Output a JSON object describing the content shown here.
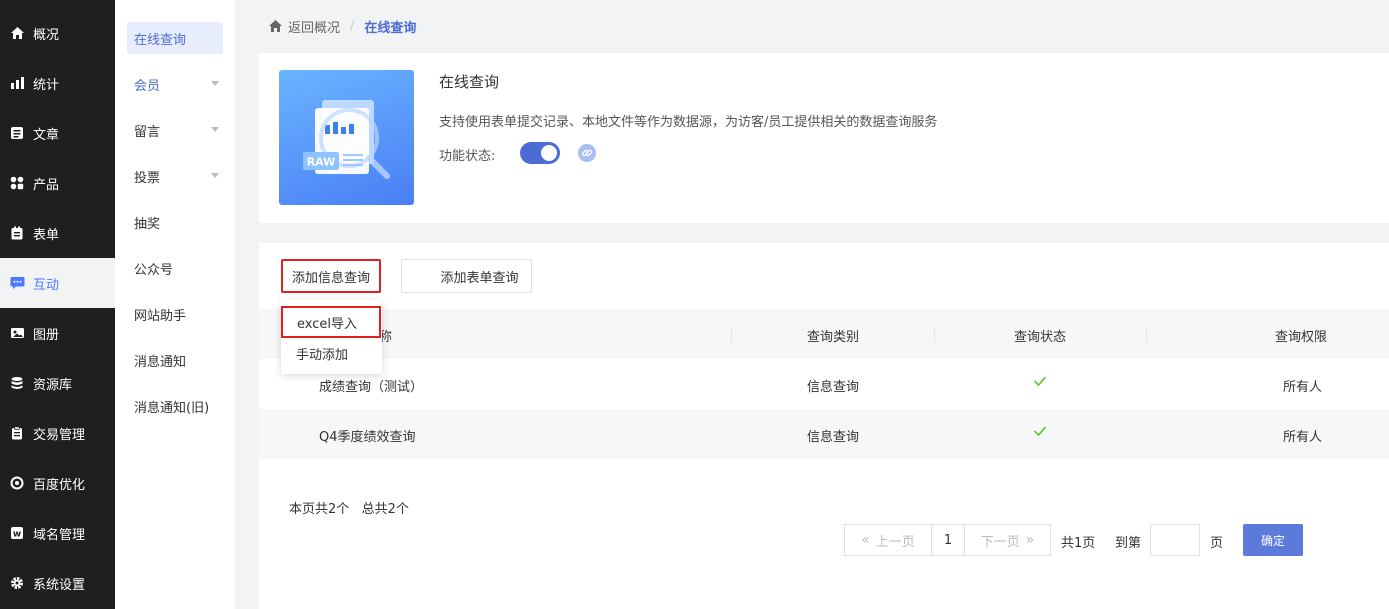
{
  "leftnav": {
    "items": [
      {
        "label": "概况",
        "icon": "home-icon"
      },
      {
        "label": "统计",
        "icon": "chart-icon"
      },
      {
        "label": "文章",
        "icon": "article-icon"
      },
      {
        "label": "产品",
        "icon": "grid-icon"
      },
      {
        "label": "表单",
        "icon": "form-icon"
      },
      {
        "label": "互动",
        "icon": "chat-icon"
      },
      {
        "label": "图册",
        "icon": "album-icon"
      },
      {
        "label": "资源库",
        "icon": "database-icon"
      },
      {
        "label": "交易管理",
        "icon": "clipboard-icon"
      },
      {
        "label": "百度优化",
        "icon": "target-icon"
      },
      {
        "label": "域名管理",
        "icon": "domain-icon"
      },
      {
        "label": "系统设置",
        "icon": "gear-icon"
      }
    ]
  },
  "subnav": {
    "items": [
      {
        "label": "在线查询"
      },
      {
        "label": "会员"
      },
      {
        "label": "留言"
      },
      {
        "label": "投票"
      },
      {
        "label": "抽奖"
      },
      {
        "label": "公众号"
      },
      {
        "label": "网站助手"
      },
      {
        "label": "消息通知"
      },
      {
        "label": "消息通知(旧)"
      }
    ]
  },
  "breadcrumb": {
    "back": "返回概况",
    "sep": "/",
    "current": "在线查询"
  },
  "feature": {
    "thumb_text": "RAW",
    "title": "在线查询",
    "description": "支持使用表单提交记录、本地文件等作为数据源，为访客/员工提供相关的数据查询服务",
    "status_label": "功能状态:"
  },
  "toolbar": {
    "add_info": "添加信息查询",
    "add_form": "添加表单查询"
  },
  "dropdown": {
    "items": [
      "excel导入",
      "手动添加"
    ]
  },
  "table": {
    "headers": {
      "name_suffix": "称",
      "type": "查询类别",
      "status": "查询状态",
      "permission": "查询权限"
    },
    "rows": [
      {
        "name": "成绩查询（测试）",
        "type": "信息查询",
        "permission": "所有人"
      },
      {
        "name": "Q4季度绩效查询",
        "type": "信息查询",
        "permission": "所有人"
      }
    ]
  },
  "summary": "本页共2个   总共2个",
  "pagination": {
    "prev": "上一页",
    "page": "1",
    "next": "下一页",
    "total": "共1页",
    "goto": "到第",
    "unit": "页",
    "confirm": "确定"
  }
}
